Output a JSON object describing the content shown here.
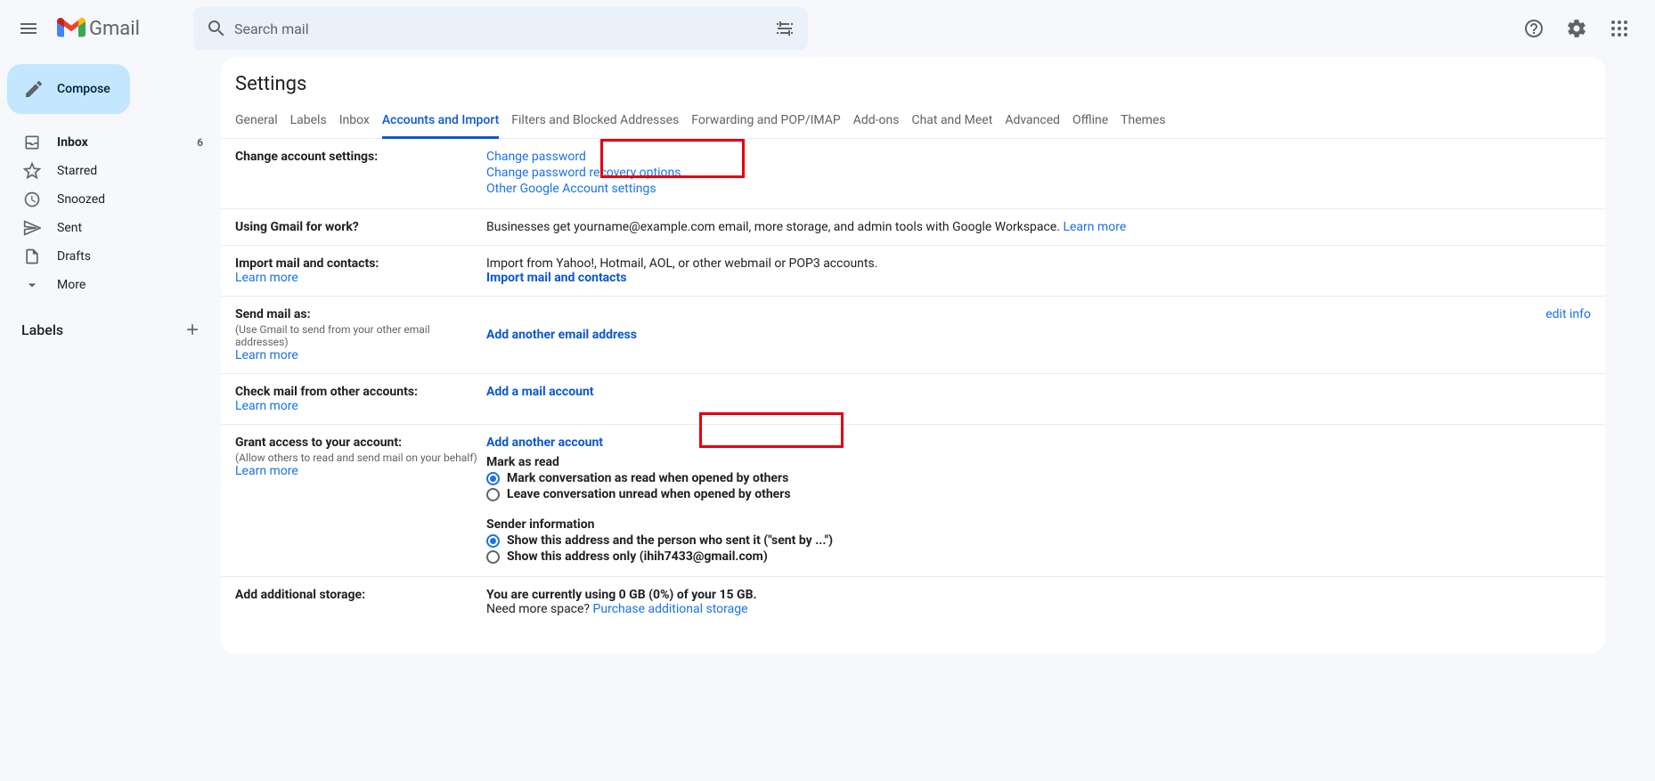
{
  "header": {
    "logo_text": "Gmail",
    "search_placeholder": "Search mail"
  },
  "compose_label": "Compose",
  "nav": [
    {
      "icon": "inbox",
      "label": "Inbox",
      "count": "6",
      "bold": true
    },
    {
      "icon": "star",
      "label": "Starred",
      "count": "",
      "bold": false
    },
    {
      "icon": "clock",
      "label": "Snoozed",
      "count": "",
      "bold": false
    },
    {
      "icon": "send",
      "label": "Sent",
      "count": "",
      "bold": false
    },
    {
      "icon": "file",
      "label": "Drafts",
      "count": "",
      "bold": false
    },
    {
      "icon": "chevron",
      "label": "More",
      "count": "",
      "bold": false
    }
  ],
  "labels_header": "Labels",
  "settings_title": "Settings",
  "tabs": [
    "General",
    "Labels",
    "Inbox",
    "Accounts and Import",
    "Filters and Blocked Addresses",
    "Forwarding and POP/IMAP",
    "Add-ons",
    "Chat and Meet",
    "Advanced",
    "Offline",
    "Themes"
  ],
  "s1": {
    "title": "Change account settings:",
    "links": [
      "Change password",
      "Change password recovery options",
      "Other Google Account settings"
    ]
  },
  "s2": {
    "title": "Using Gmail for work?",
    "text": "Businesses get yourname@example.com email, more storage, and admin tools with Google Workspace. ",
    "link": "Learn more"
  },
  "s3": {
    "title": "Import mail and contacts:",
    "learn": "Learn more",
    "text": "Import from Yahoo!, Hotmail, AOL, or other webmail or POP3 accounts.",
    "action": "Import mail and contacts"
  },
  "s4": {
    "title": "Send mail as:",
    "sub": "(Use Gmail to send from your other email addresses)",
    "learn": "Learn more",
    "action": "Add another email address",
    "edit": "edit info"
  },
  "s5": {
    "title": "Check mail from other accounts:",
    "learn": "Learn more",
    "action": "Add a mail account"
  },
  "s6": {
    "title": "Grant access to your account:",
    "sub": "(Allow others to read and send mail on your behalf)",
    "learn": "Learn more",
    "action": "Add another account",
    "p1": "Mark as read",
    "r1": "Mark conversation as read when opened by others",
    "r2": "Leave conversation unread when opened by others",
    "p2": "Sender information",
    "r3": "Show this address and the person who sent it (\"sent by ...\")",
    "r4": "Show this address only (ihih7433@gmail.com)"
  },
  "s7": {
    "title": "Add additional storage:",
    "t1": "You are currently using 0 GB (0%) of your 15 GB.",
    "t2": "Need more space? ",
    "link": "Purchase additional storage"
  }
}
